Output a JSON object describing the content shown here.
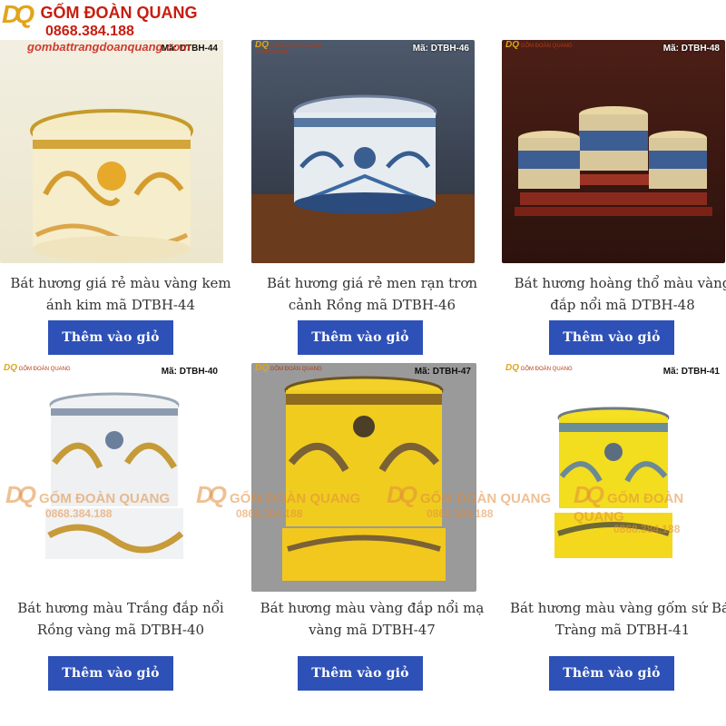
{
  "brand": {
    "logo_mark": "DQ",
    "name": "GỐM ĐOÀN QUANG",
    "phone": "0868.384.188",
    "website": "gombattrangdoanquang.com"
  },
  "button_label": "Thêm vào giỏ",
  "products": [
    {
      "code": "Mã: DTBH-44",
      "title": "Bát hương giá rẻ màu vàng kem ánh kim mã DTBH-44"
    },
    {
      "code": "Mã: DTBH-46",
      "title": "Bát hương giá rẻ men rạn trơn cảnh Rồng mã DTBH-46"
    },
    {
      "code": "Mã: DTBH-48",
      "title": "Bát hương hoàng thổ màu vàng đắp nổi mã DTBH-48"
    },
    {
      "code": "Mã: DTBH-40",
      "title": "Bát hương màu Trắng đắp nổi Rồng vàng mã DTBH-40"
    },
    {
      "code": "Mã: DTBH-47",
      "title": "Bát hương màu vàng đắp nổi mạ vàng mã DTBH-47"
    },
    {
      "code": "Mã: DTBH-41",
      "title": "Bát hương màu vàng gốm sứ Bát Tràng mã DTBH-41"
    }
  ],
  "colors": {
    "button": "#2e51b8",
    "brand_red": "#c81d10",
    "brand_gold": "#e0a51a"
  }
}
